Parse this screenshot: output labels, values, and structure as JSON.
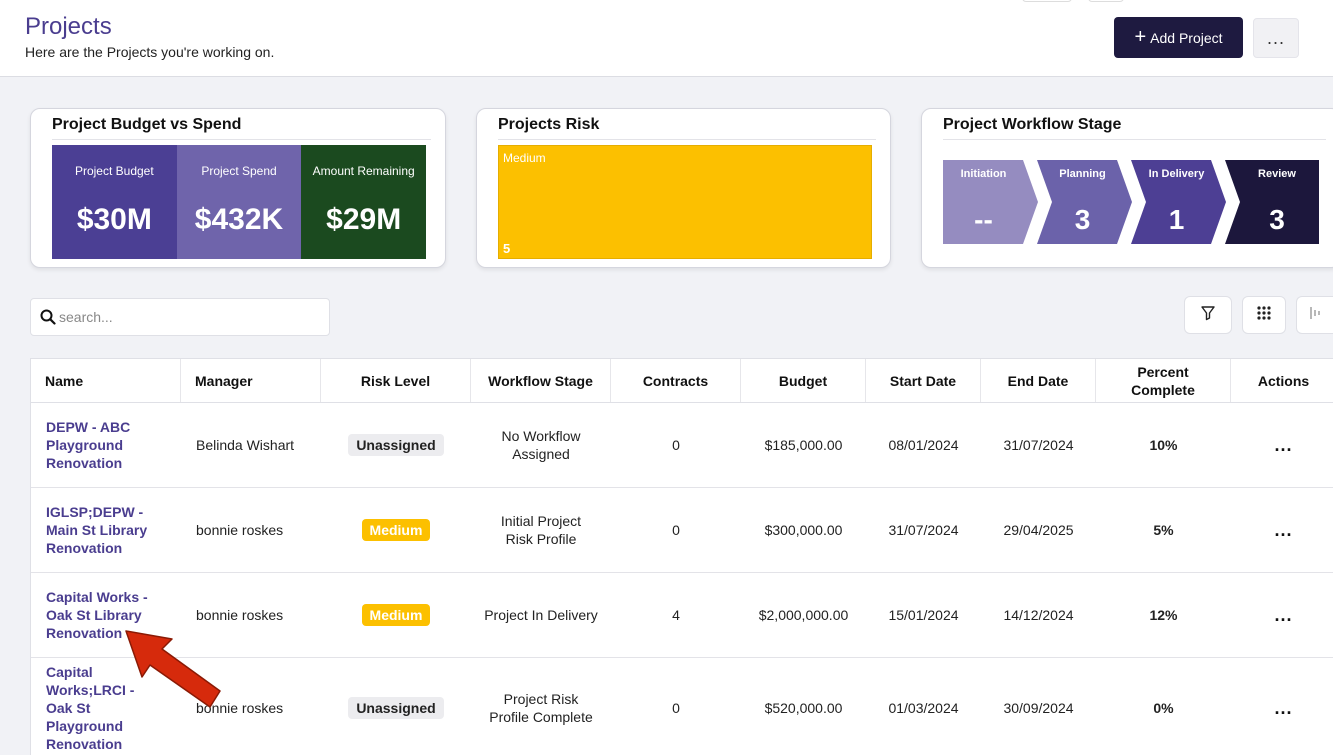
{
  "header": {
    "title": "Projects",
    "subtitle": "Here are the Projects you're working on.",
    "add_label": "Add Project",
    "more_label": "..."
  },
  "cards": {
    "budget": {
      "title": "Project Budget vs Spend",
      "cells": [
        {
          "label": "Project Budget",
          "value": "$30M",
          "color": "#4b3f94"
        },
        {
          "label": "Project Spend",
          "value": "$432K",
          "color": "#6f64ab"
        },
        {
          "label": "Amount Remaining",
          "value": "$29M",
          "color": "#1b4a1f"
        }
      ]
    },
    "risk": {
      "title": "Projects Risk",
      "label": "Medium",
      "count": "5",
      "color": "#fcc000"
    },
    "workflow": {
      "title": "Project Workflow Stage",
      "steps": [
        {
          "label": "Initiation",
          "value": "--",
          "color": "#958cc0"
        },
        {
          "label": "Planning",
          "value": "3",
          "color": "#6b62aa"
        },
        {
          "label": "In Delivery",
          "value": "1",
          "color": "#4d3f94"
        },
        {
          "label": "Review",
          "value": "3",
          "color": "#1c173c"
        }
      ]
    }
  },
  "search": {
    "placeholder": "search..."
  },
  "table": {
    "columns": [
      "Name",
      "Manager",
      "Risk Level",
      "Workflow Stage",
      "Contracts",
      "Budget",
      "Start Date",
      "End Date",
      "Percent Complete",
      "Actions"
    ],
    "rows": [
      {
        "name": "DEPW - ABC Playground Renovation",
        "manager": "Belinda Wishart",
        "risk": "Unassigned",
        "stage": "No Workflow Assigned",
        "contracts": "0",
        "budget": "$185,000.00",
        "start": "08/01/2024",
        "end": "31/07/2024",
        "percent": "10%",
        "actions": "..."
      },
      {
        "name": "IGLSP;DEPW - Main St Library Renovation",
        "manager": "bonnie roskes",
        "risk": "Medium",
        "stage": "Initial Project Risk Profile",
        "contracts": "0",
        "budget": "$300,000.00",
        "start": "31/07/2024",
        "end": "29/04/2025",
        "percent": "5%",
        "actions": "..."
      },
      {
        "name": "Capital Works - Oak St Library Renovation",
        "manager": "bonnie roskes",
        "risk": "Medium",
        "stage": "Project In Delivery",
        "contracts": "4",
        "budget": "$2,000,000.00",
        "start": "15/01/2024",
        "end": "14/12/2024",
        "percent": "12%",
        "actions": "..."
      },
      {
        "name": "Capital Works;LRCI - Oak St Playground Renovation",
        "manager": "bonnie roskes",
        "risk": "Unassigned",
        "stage": "Project Risk Profile Complete",
        "contracts": "0",
        "budget": "$520,000.00",
        "start": "01/03/2024",
        "end": "30/09/2024",
        "percent": "0%",
        "actions": "..."
      }
    ]
  }
}
